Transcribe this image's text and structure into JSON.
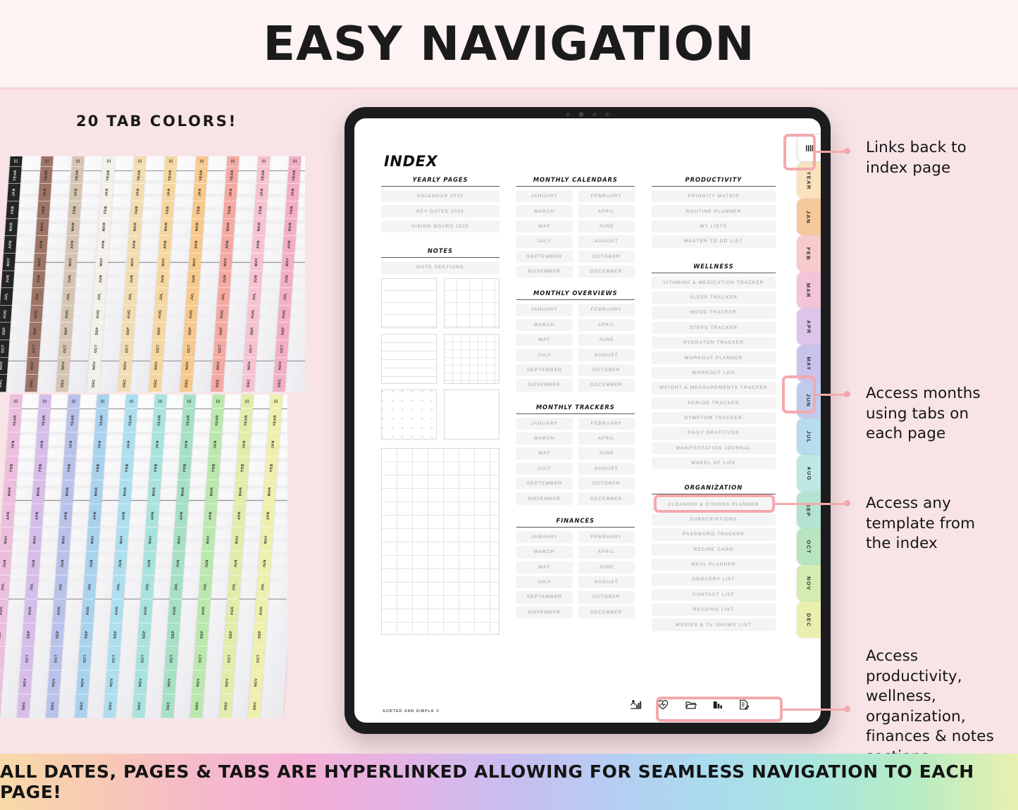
{
  "header": {
    "title": "EASY NAVIGATION"
  },
  "left_panel": {
    "tab_colors_label_bold": "20 TAB",
    "tab_colors_label_rest": " COLORS!",
    "sample_tab_labels": [
      "YEAR",
      "JAN",
      "FEB",
      "MAR",
      "APR",
      "MAY",
      "JUN",
      "JUL",
      "AUG",
      "SEP",
      "OCT",
      "NOV",
      "DEC"
    ],
    "top_row_colors": [
      "#252525",
      "#9d7467",
      "#d6c4b3",
      "#f3f0ea",
      "#f2ddb0",
      "#f6d79f",
      "#f7c98c",
      "#f4a9a2",
      "#f7c2cf",
      "#f3aec6"
    ],
    "bottom_row_colors": [
      "#edbede",
      "#d7bde9",
      "#b9c2ea",
      "#a9d2ee",
      "#addfee",
      "#a9e3dd",
      "#a6e0c6",
      "#bbe8ae",
      "#e3ecab",
      "#eef0ae"
    ]
  },
  "tablet": {
    "index": {
      "page_title": "INDEX",
      "footer": "SORTED AND SIMPLE ©",
      "column1": {
        "sections": [
          {
            "heading": "YEARLY PAGES",
            "items": [
              "CALENDAR 2025",
              "KEY DATES 2025",
              "VISION BOARD 2025"
            ]
          },
          {
            "heading": "NOTES",
            "items": [
              "NOTE SECTIONS"
            ]
          }
        ],
        "note_previews": [
          "lined",
          "grid4",
          "lined2",
          "grid8",
          "dotted",
          "blank"
        ]
      },
      "column2": {
        "sections": [
          {
            "heading": "MONTHLY CALENDARS",
            "items": [
              "JANUARY",
              "FEBRUARY",
              "MARCH",
              "APRIL",
              "MAY",
              "JUNE",
              "JULY",
              "AUGUST",
              "SEPTEMBER",
              "OCTOBER",
              "NOVEMBER",
              "DECEMBER"
            ]
          },
          {
            "heading": "MONTHLY OVERVIEWS",
            "items": [
              "JANUARY",
              "FEBRUARY",
              "MARCH",
              "APRIL",
              "MAY",
              "JUNE",
              "JULY",
              "AUGUST",
              "SEPTEMBER",
              "OCTOBER",
              "NOVEMBER",
              "DECEMBER"
            ]
          },
          {
            "heading": "MONTHLY TRACKERS",
            "items": [
              "JANUARY",
              "FEBRUARY",
              "MARCH",
              "APRIL",
              "MAY",
              "JUNE",
              "JULY",
              "AUGUST",
              "SEPTEMBER",
              "OCTOBER",
              "NOVEMBER",
              "DECEMBER"
            ]
          },
          {
            "heading": "FINANCES",
            "items": [
              "JANUARY",
              "FEBRUARY",
              "MARCH",
              "APRIL",
              "MAY",
              "JUNE",
              "JULY",
              "AUGUST",
              "SEPTEMBER",
              "OCTOBER",
              "NOVEMBER",
              "DECEMBER"
            ]
          }
        ]
      },
      "column3": {
        "sections": [
          {
            "heading": "PRODUCTIVITY",
            "items": [
              "PRIORITY MATRIX",
              "ROUTINE PLANNER",
              "MY LISTS",
              "MASTER TO DO LIST"
            ]
          },
          {
            "heading": "WELLNESS",
            "items": [
              "VITAMINS & MEDICATION TRACKER",
              "SLEEP TRACKER",
              "MOOD TRACKER",
              "STEPS TRACKER",
              "HYDRATON TRACKER",
              "WORKOUT PLANNER",
              "WORKOUT LOG",
              "WEIGHT & MEASUREMENTS TRACKER",
              "PERIOD TRACKER",
              "SYMPTOM TRACKER",
              "DAILY GRATITUDE",
              "MANIFESTATION JOURNAL",
              "WHEEL OF LIFE"
            ]
          },
          {
            "heading": "ORGANIZATION",
            "items": [
              "CLEANING & CHORES PLANNER",
              "SUBSCRIPTIONS",
              "PASSWORD TRACKER",
              "RECIPE CARD",
              "MEAL PLANNER",
              "GROCERY LIST",
              "CONTACT LIST",
              "READING LIST",
              "MOVIES & TV SHOWS LIST"
            ]
          }
        ]
      }
    },
    "icon_bar": [
      {
        "name": "productivity-icon",
        "label": "PRODUCTIVITY"
      },
      {
        "name": "wellness-heart-icon",
        "label": "WELLNESS"
      },
      {
        "name": "organization-folder-icon",
        "label": "ORGANIZATION"
      },
      {
        "name": "finances-chart-icon",
        "label": "FINANCES"
      },
      {
        "name": "notes-document-icon",
        "label": "NOTES"
      }
    ],
    "tab_rail": {
      "index_tab": {
        "name": "index-menu-icon",
        "label": "INDEX"
      },
      "tabs": [
        {
          "label": "YEAR",
          "color": "#fae2bd"
        },
        {
          "label": "JAN",
          "color": "#f5c99b"
        },
        {
          "label": "FEB",
          "color": "#f7cbcb"
        },
        {
          "label": "MAR",
          "color": "#f2c3d9"
        },
        {
          "label": "APR",
          "color": "#ddc5e9"
        },
        {
          "label": "MAY",
          "color": "#c8c3ea"
        },
        {
          "label": "JUN",
          "color": "#c0cbec"
        },
        {
          "label": "JUL",
          "color": "#b7dced"
        },
        {
          "label": "AUG",
          "color": "#bfe8e4"
        },
        {
          "label": "SEP",
          "color": "#b4e3d1"
        },
        {
          "label": "OCT",
          "color": "#b8e4bf"
        },
        {
          "label": "NOV",
          "color": "#d4ebb1"
        },
        {
          "label": "DEC",
          "color": "#eaefb0"
        }
      ]
    }
  },
  "annotations": [
    {
      "id": "links-index",
      "text": "Links back to\nindex page"
    },
    {
      "id": "access-months",
      "text": "Access months\nusing tabs on\neach page"
    },
    {
      "id": "access-template",
      "text": "Access any\ntemplate from\nthe index"
    },
    {
      "id": "access-sections",
      "text": "Access\nproductivity,\nwellness,\norganization,\nfinances & notes\nsections"
    }
  ],
  "banner": {
    "text": "ALL DATES, PAGES & TABS ARE HYPERLINKED ALLOWING FOR SEAMLESS NAVIGATION TO EACH PAGE!"
  },
  "colors": {
    "accent_pink": "#f4a9ad",
    "background": "#f8e4e6",
    "header_bg": "#fdf3f3"
  }
}
